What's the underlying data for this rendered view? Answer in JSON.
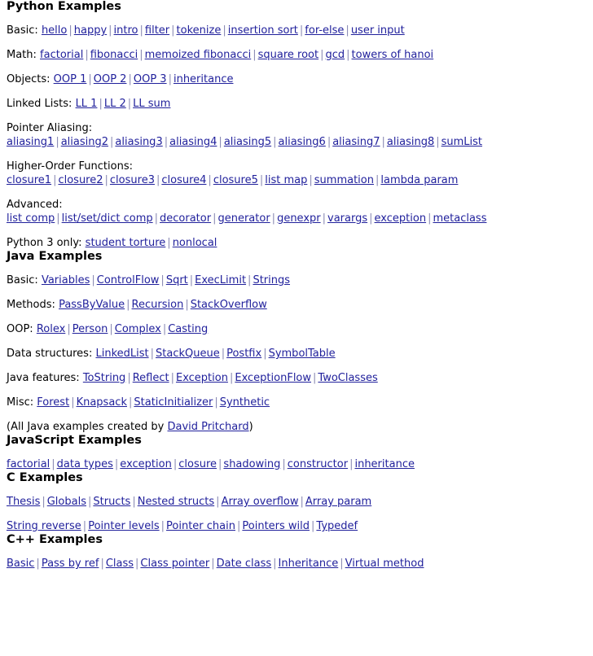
{
  "page": {
    "background_color": "#ffffff",
    "link_color": "#21219c",
    "separator_color": "#8b8bb5",
    "text_color": "#000000",
    "separator": "|"
  },
  "sections": [
    {
      "heading": "Python Examples",
      "rows": [
        {
          "type": "inline",
          "label": "Basic:",
          "links": [
            "hello",
            "happy",
            "intro",
            "filter",
            "tokenize",
            "insertion sort",
            "for-else",
            "user input"
          ]
        },
        {
          "type": "inline",
          "label": "Math:",
          "links": [
            "factorial",
            "fibonacci",
            "memoized fibonacci",
            "square root",
            "gcd",
            "towers of hanoi"
          ]
        },
        {
          "type": "inline",
          "label": "Objects:",
          "links": [
            "OOP 1",
            "OOP 2",
            "OOP 3",
            "inheritance"
          ]
        },
        {
          "type": "inline",
          "label": "Linked Lists:",
          "links": [
            "LL 1",
            "LL 2",
            "LL sum"
          ]
        },
        {
          "type": "stacked",
          "label": "Pointer Aliasing:",
          "links": [
            "aliasing1",
            "aliasing2",
            "aliasing3",
            "aliasing4",
            "aliasing5",
            "aliasing6",
            "aliasing7",
            "aliasing8",
            "sumList"
          ]
        },
        {
          "type": "stacked",
          "label": "Higher-Order Functions:",
          "links": [
            "closure1",
            "closure2",
            "closure3",
            "closure4",
            "closure5",
            "list map",
            "summation",
            "lambda param"
          ]
        },
        {
          "type": "stacked",
          "label": "Advanced:",
          "links": [
            "list comp",
            "list/set/dict comp",
            "decorator",
            "generator",
            "genexpr",
            "varargs",
            "exception",
            "metaclass"
          ]
        },
        {
          "type": "inline",
          "label": "Python 3 only:",
          "links": [
            "student torture",
            "nonlocal"
          ]
        }
      ]
    },
    {
      "heading": "Java Examples",
      "rows": [
        {
          "type": "inline",
          "label": "Basic:",
          "links": [
            "Variables",
            "ControlFlow",
            "Sqrt",
            "ExecLimit",
            "Strings"
          ]
        },
        {
          "type": "inline",
          "label": "Methods:",
          "links": [
            "PassByValue",
            "Recursion",
            "StackOverflow"
          ]
        },
        {
          "type": "inline",
          "label": "OOP:",
          "links": [
            "Rolex",
            "Person",
            "Complex",
            "Casting"
          ]
        },
        {
          "type": "inline",
          "label": "Data structures:",
          "links": [
            "LinkedList",
            "StackQueue",
            "Postfix",
            "SymbolTable"
          ]
        },
        {
          "type": "inline",
          "label": "Java features:",
          "links": [
            "ToString",
            "Reflect",
            "Exception",
            "ExceptionFlow",
            "TwoClasses"
          ]
        },
        {
          "type": "inline",
          "label": "Misc:",
          "links": [
            "Forest",
            "Knapsack",
            "StaticInitializer",
            "Synthetic"
          ]
        },
        {
          "type": "credit",
          "prefix": "(All Java examples created by ",
          "link": "David Pritchard",
          "suffix": ")"
        }
      ]
    },
    {
      "heading": "JavaScript Examples",
      "rows": [
        {
          "type": "links-only",
          "links": [
            "factorial",
            "data types",
            "exception",
            "closure",
            "shadowing",
            "constructor",
            "inheritance"
          ]
        }
      ]
    },
    {
      "heading": "C Examples",
      "rows": [
        {
          "type": "links-only",
          "links": [
            "Thesis",
            "Globals",
            "Structs",
            "Nested structs",
            "Array overflow",
            "Array param"
          ]
        },
        {
          "type": "links-only",
          "links": [
            "String reverse",
            "Pointer levels",
            "Pointer chain",
            "Pointers wild",
            "Typedef"
          ]
        }
      ]
    },
    {
      "heading": "C++ Examples",
      "rows": [
        {
          "type": "links-only",
          "links": [
            "Basic",
            "Pass by ref",
            "Class",
            "Class pointer",
            "Date class",
            "Inheritance",
            "Virtual method"
          ]
        }
      ]
    }
  ]
}
